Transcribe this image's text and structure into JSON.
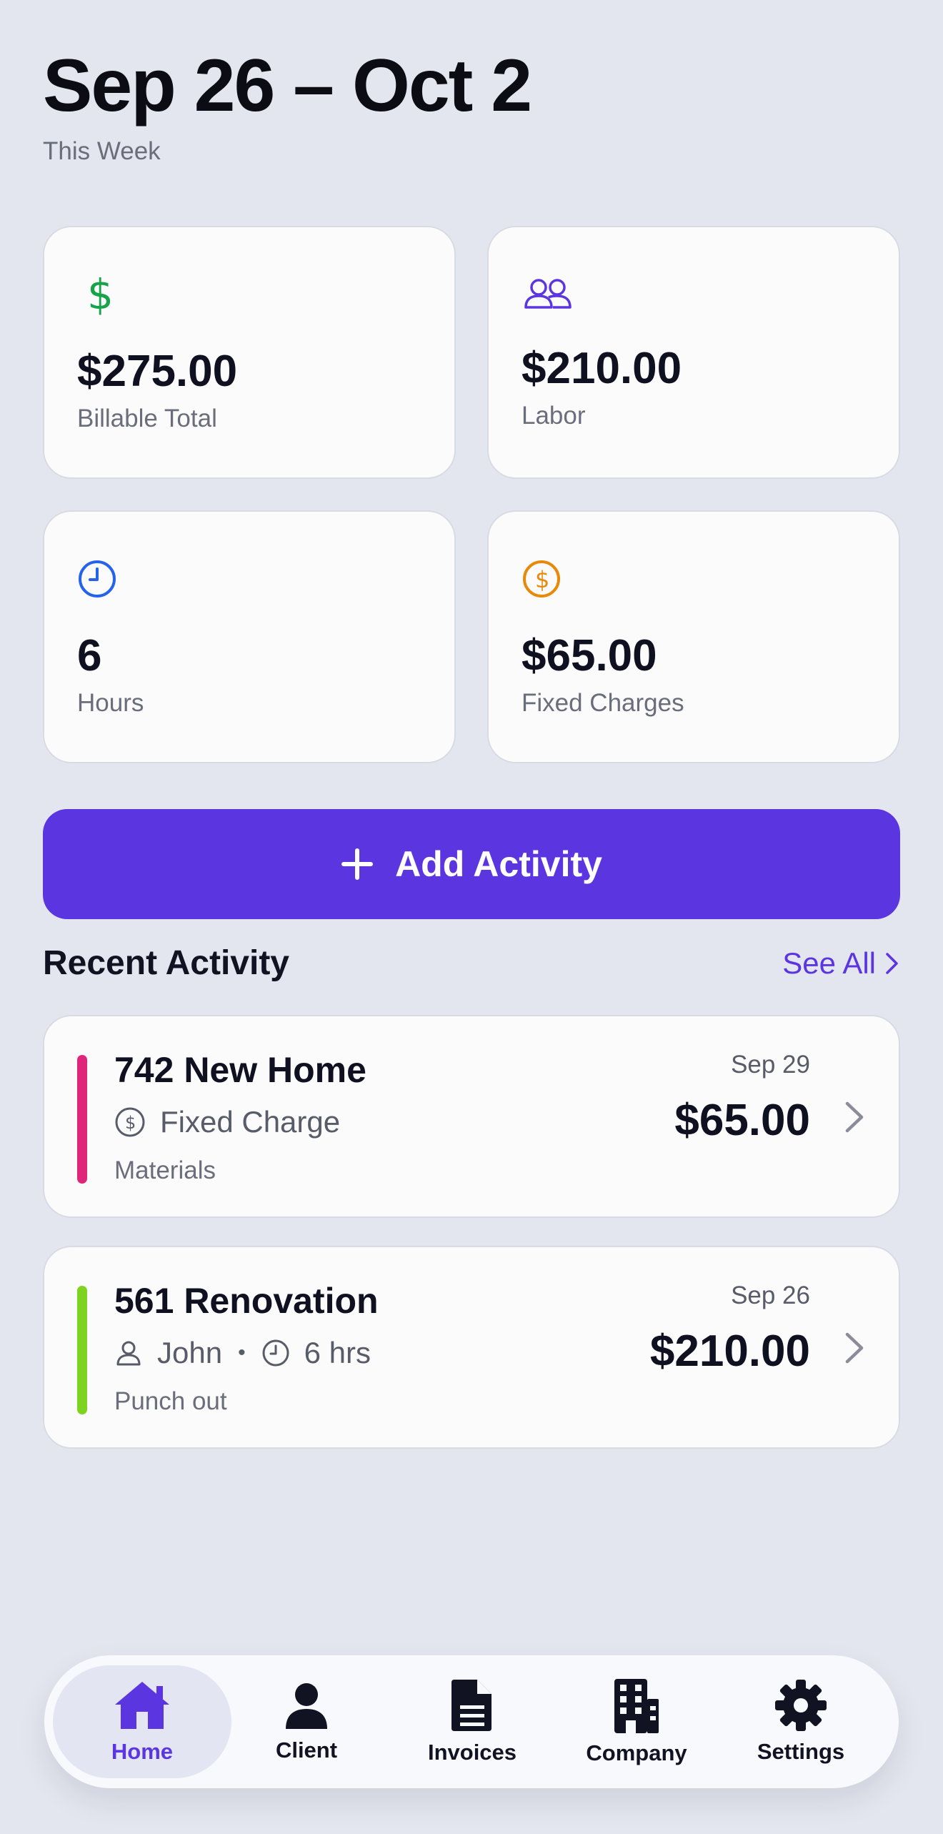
{
  "header": {
    "date_range": "Sep 26 – Oct 2",
    "subtitle": "This Week"
  },
  "stats": [
    {
      "icon": "dollar-icon",
      "value": "$275.00",
      "label": "Billable Total",
      "color": "#16a34a"
    },
    {
      "icon": "users-icon",
      "value": "$210.00",
      "label": "Labor",
      "color": "#5b36e0"
    },
    {
      "icon": "clock-icon",
      "value": "6",
      "label": "Hours",
      "color": "#2563eb"
    },
    {
      "icon": "dollar-circle-icon",
      "value": "$65.00",
      "label": "Fixed Charges",
      "color": "#e8890c"
    }
  ],
  "add_button": {
    "icon": "plus-icon",
    "label": "Add Activity"
  },
  "recent": {
    "title": "Recent Activity",
    "see_all": "See All",
    "items": [
      {
        "title": "742 New Home",
        "meta_icon": "dollar-circle-icon",
        "meta_text": "Fixed Charge",
        "subtitle": "Materials",
        "date": "Sep 29",
        "amount": "$65.00",
        "accent": "#e0267a"
      },
      {
        "title": "561 Renovation",
        "meta_person": "John",
        "meta_separator": "•",
        "meta_hours": "6 hrs",
        "subtitle": "Punch out",
        "date": "Sep 26",
        "amount": "$210.00",
        "accent": "#7ed321"
      }
    ]
  },
  "tabs": [
    {
      "icon": "home-icon",
      "label": "Home",
      "active": true
    },
    {
      "icon": "person-icon",
      "label": "Client",
      "active": false
    },
    {
      "icon": "document-icon",
      "label": "Invoices",
      "active": false
    },
    {
      "icon": "building-icon",
      "label": "Company",
      "active": false
    },
    {
      "icon": "gear-icon",
      "label": "Settings",
      "active": false
    }
  ],
  "colors": {
    "accent": "#5b36e0",
    "background": "#e3e6ee",
    "card": "#fbfbfc"
  }
}
